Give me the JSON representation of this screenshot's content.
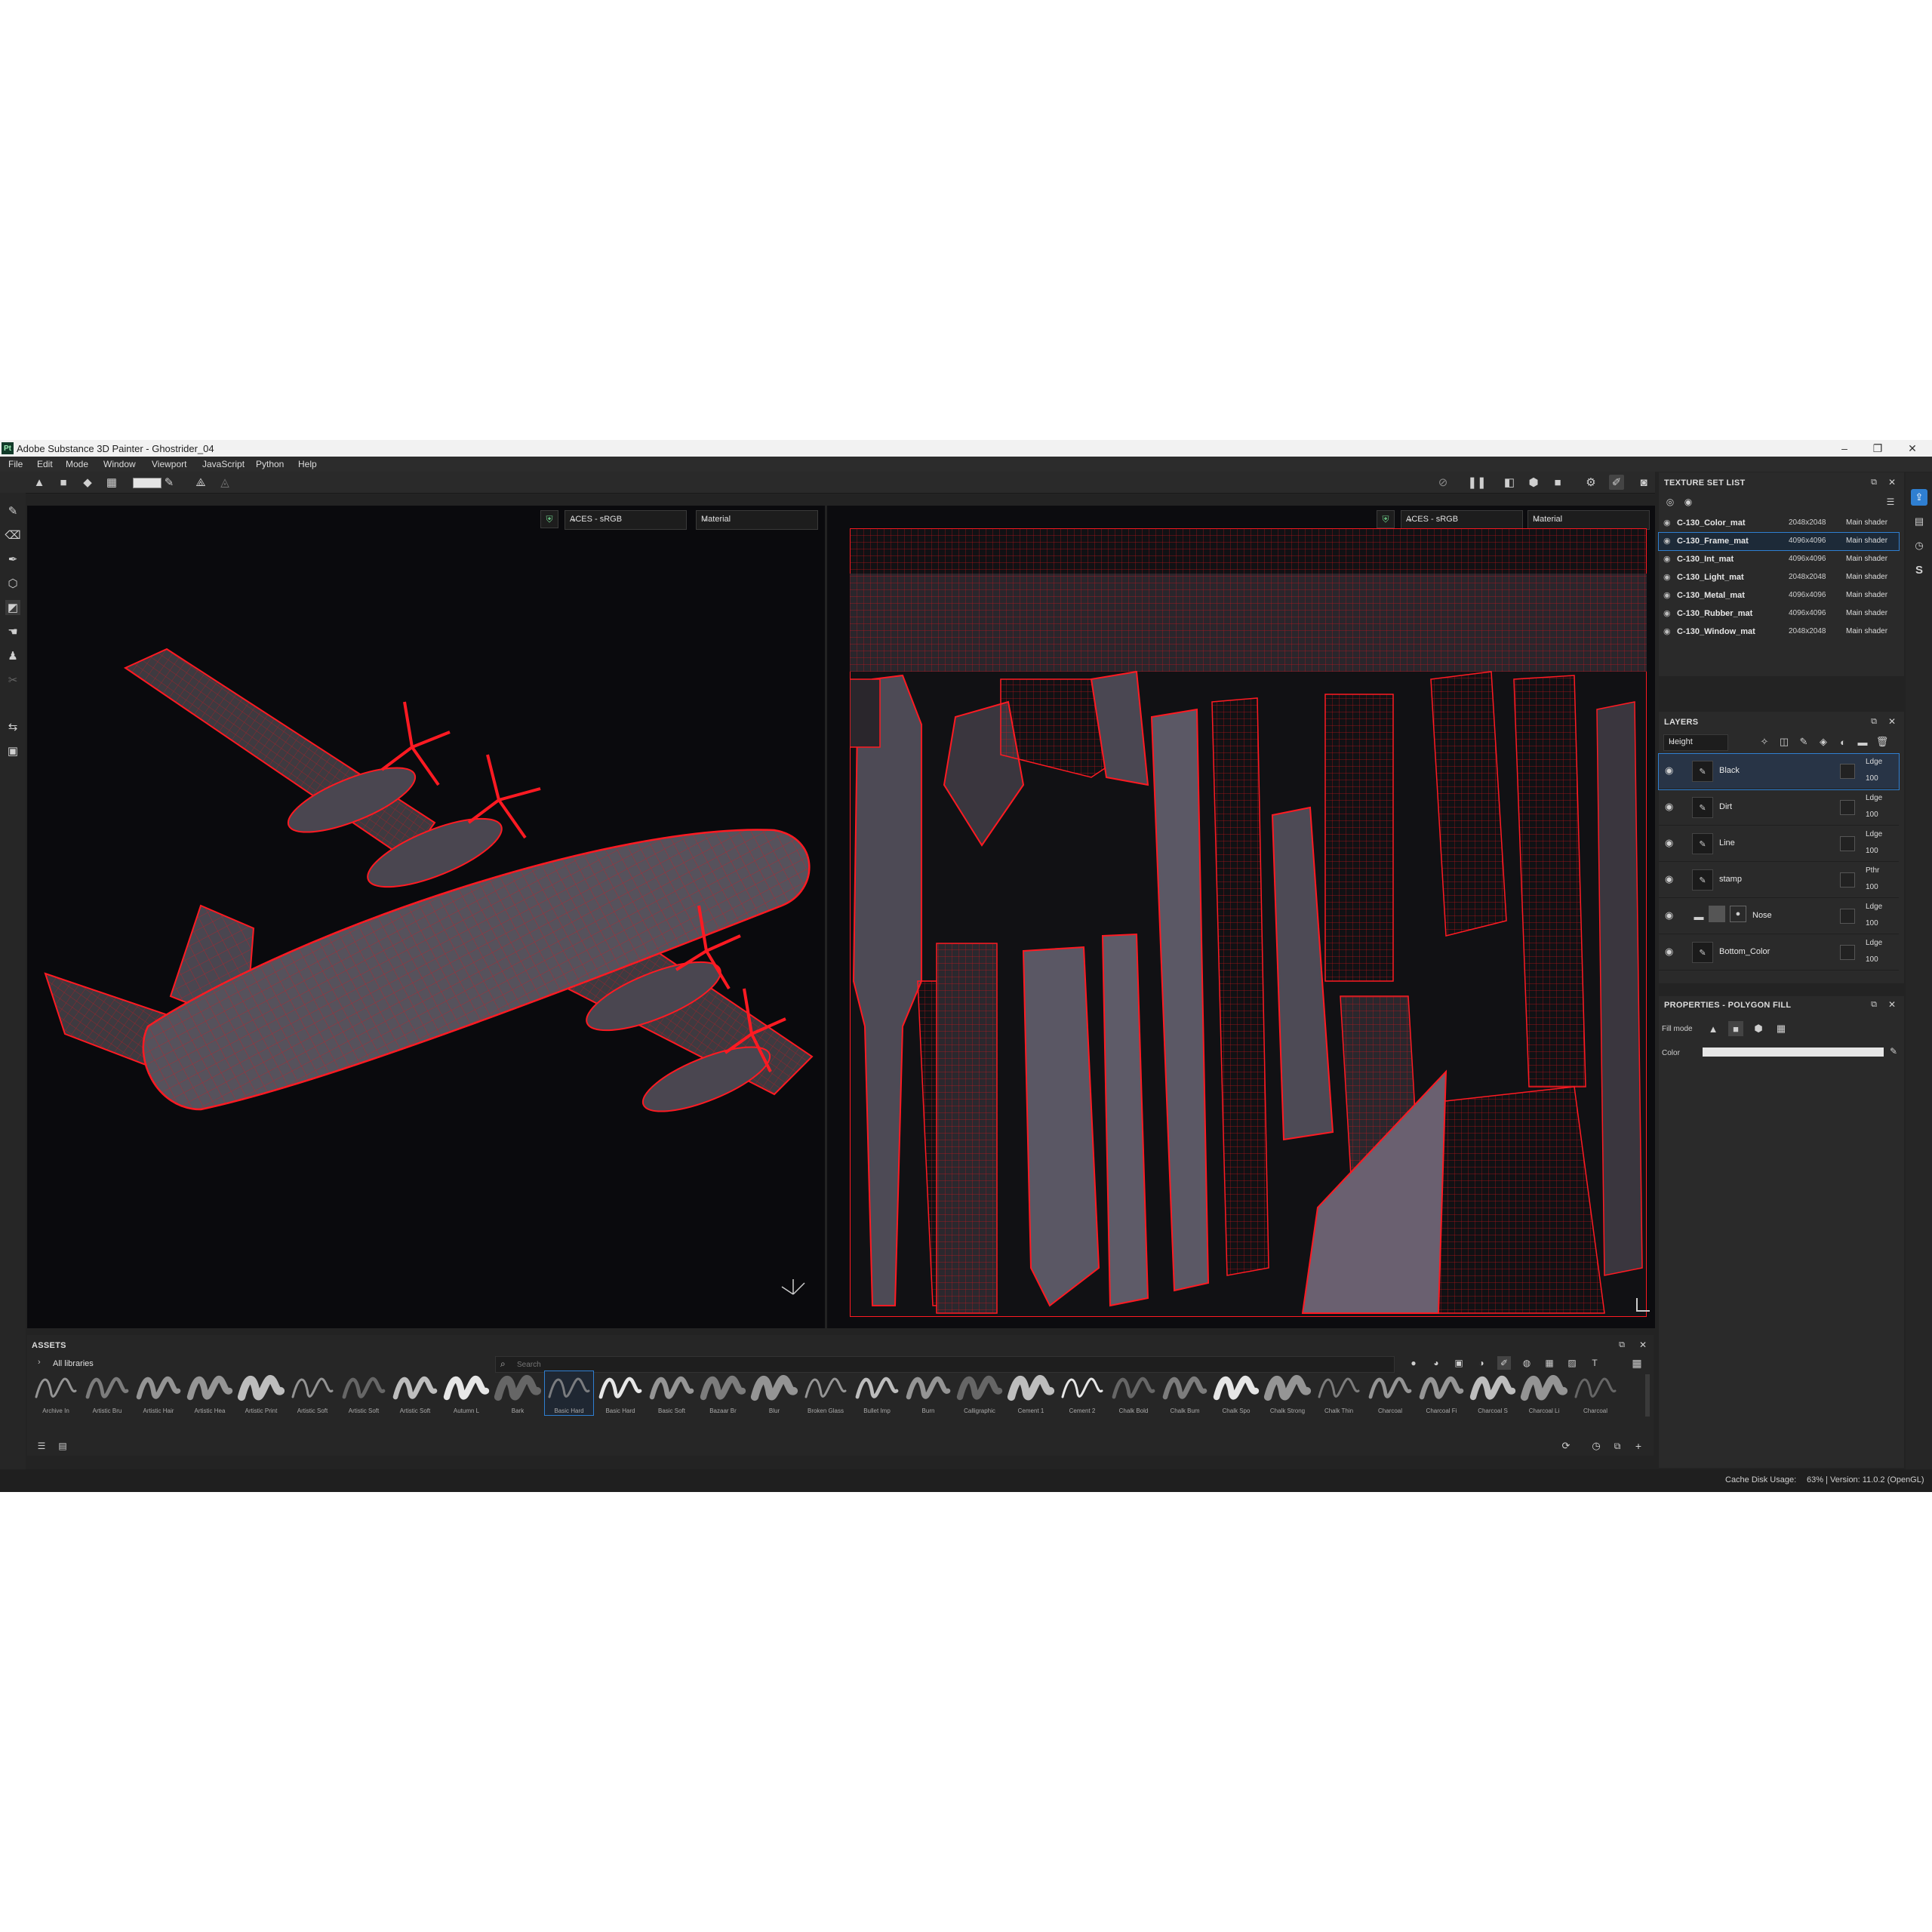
{
  "window": {
    "logo": "Pt",
    "title": "Adobe Substance 3D Painter - Ghostrider_04",
    "minimize": "–",
    "restore": "❐",
    "close": "✕"
  },
  "menu": [
    "File",
    "Edit",
    "Mode",
    "Window",
    "Viewport",
    "JavaScript",
    "Python",
    "Help"
  ],
  "viewport3d": {
    "colorspace": "ACES - sRGB",
    "channel": "Material"
  },
  "viewport2d": {
    "colorspace": "ACES - sRGB",
    "channel": "Material"
  },
  "texture_set_list": {
    "title": "TEXTURE SET LIST",
    "items": [
      {
        "name": "C-130_Color_mat",
        "resolution": "2048x2048",
        "shader": "Main shader"
      },
      {
        "name": "C-130_Frame_mat",
        "resolution": "4096x4096",
        "shader": "Main shader"
      },
      {
        "name": "C-130_Int_mat",
        "resolution": "4096x4096",
        "shader": "Main shader"
      },
      {
        "name": "C-130_Light_mat",
        "resolution": "2048x2048",
        "shader": "Main shader"
      },
      {
        "name": "C-130_Metal_mat",
        "resolution": "4096x4096",
        "shader": "Main shader"
      },
      {
        "name": "C-130_Rubber_mat",
        "resolution": "4096x4096",
        "shader": "Main shader"
      },
      {
        "name": "C-130_Window_mat",
        "resolution": "2048x2048",
        "shader": "Main shader"
      }
    ]
  },
  "layers": {
    "title": "LAYERS",
    "channel": "Height",
    "items": [
      {
        "name": "Black",
        "blend": "Ldge",
        "opacity": "100"
      },
      {
        "name": "Dirt",
        "blend": "Ldge",
        "opacity": "100"
      },
      {
        "name": "Line",
        "blend": "Ldge",
        "opacity": "100"
      },
      {
        "name": "stamp",
        "blend": "Pthr",
        "opacity": "100"
      },
      {
        "name": "Nose",
        "blend": "Ldge",
        "opacity": "100"
      },
      {
        "name": "Bottom_Color",
        "blend": "Ldge",
        "opacity": "100"
      }
    ]
  },
  "properties": {
    "title": "PROPERTIES - POLYGON FILL",
    "fill_mode_label": "Fill mode",
    "color_label": "Color"
  },
  "assets": {
    "title": "ASSETS",
    "library": "All libraries",
    "search_placeholder": "Search",
    "brushes": [
      "Archive In",
      "Artistic Bru",
      "Artistic Hair",
      "Artistic Hea",
      "Artistic Print",
      "Artistic Soft",
      "Artistic Soft",
      "Artistic Soft",
      "Autumn L",
      "Bark",
      "Basic Hard",
      "Basic Hard",
      "Basic Soft",
      "Bazaar Br",
      "Blur",
      "Broken Glass",
      "Bullet Imp",
      "Burn",
      "Calligraphic",
      "Cement 1",
      "Cement 2",
      "Chalk Bold",
      "Chalk Bum",
      "Chalk Spo",
      "Chalk Strong",
      "Chalk Thin",
      "Charcoal",
      "Charcoal Fi",
      "Charcoal S",
      "Charcoal Li",
      "Charcoal"
    ]
  },
  "status": {
    "cache_label": "Cache Disk Usage:",
    "cache_value": "63% | Version: 11.0.2 (OpenGL)"
  },
  "colors": {
    "wire": "#e0131c",
    "panel": "#2a2a2a",
    "viewport_bg": "#0a0a0d",
    "accent": "#2f7fd1"
  }
}
